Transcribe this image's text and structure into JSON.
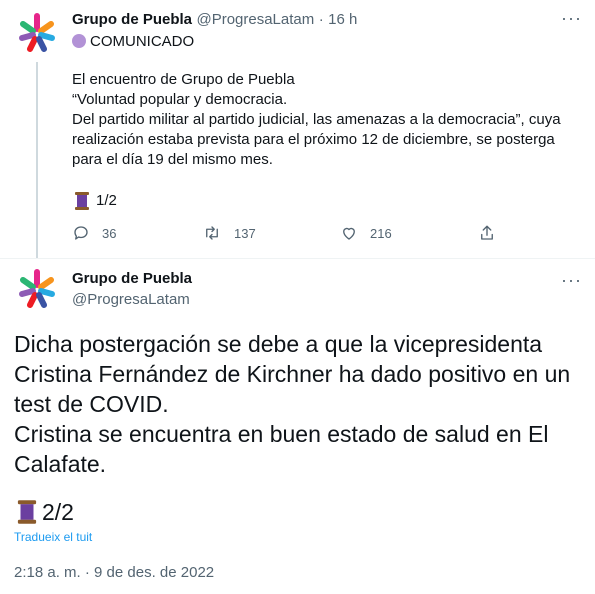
{
  "tweet1": {
    "name": "Grupo de Puebla",
    "handle": "@ProgresaLatam",
    "separator": "·",
    "time": "16 h",
    "more": "···",
    "tag": "COMUNICADO",
    "lines": [
      "El encuentro de Grupo de Puebla",
      "“Voluntad popular y democracia.",
      "Del partido militar al partido judicial, las amenazas a la democracia”, cuya",
      "realización estaba prevista para el próximo 12 de diciembre, se posterga",
      "para el día 19 del mismo mes."
    ],
    "counter": "1/2",
    "replies": "36",
    "retweets": "137",
    "likes": "216"
  },
  "tweet2": {
    "name": "Grupo de Puebla",
    "handle": "@ProgresaLatam",
    "more": "···",
    "lines": [
      "Dicha postergación se debe a que la vicepresidenta",
      "Cristina Fernández de Kirchner ha dado positivo en un",
      "test de COVID.",
      "Cristina se encuentra en buen estado de salud en El",
      "Calafate."
    ],
    "counter": "2/2",
    "translate": "Tradueix el tuit",
    "timestamp": "2:18 a. m. · 9 de des. de 2022"
  },
  "colors": {
    "accent": "#1d9bf0",
    "secondary_text": "#536471",
    "tag_dot": "#b292d6",
    "spool": "#6b3fa0"
  },
  "icons": [
    "logo-icon",
    "reply-icon",
    "retweet-icon",
    "like-icon",
    "share-icon",
    "spool-icon",
    "more-icon"
  ]
}
